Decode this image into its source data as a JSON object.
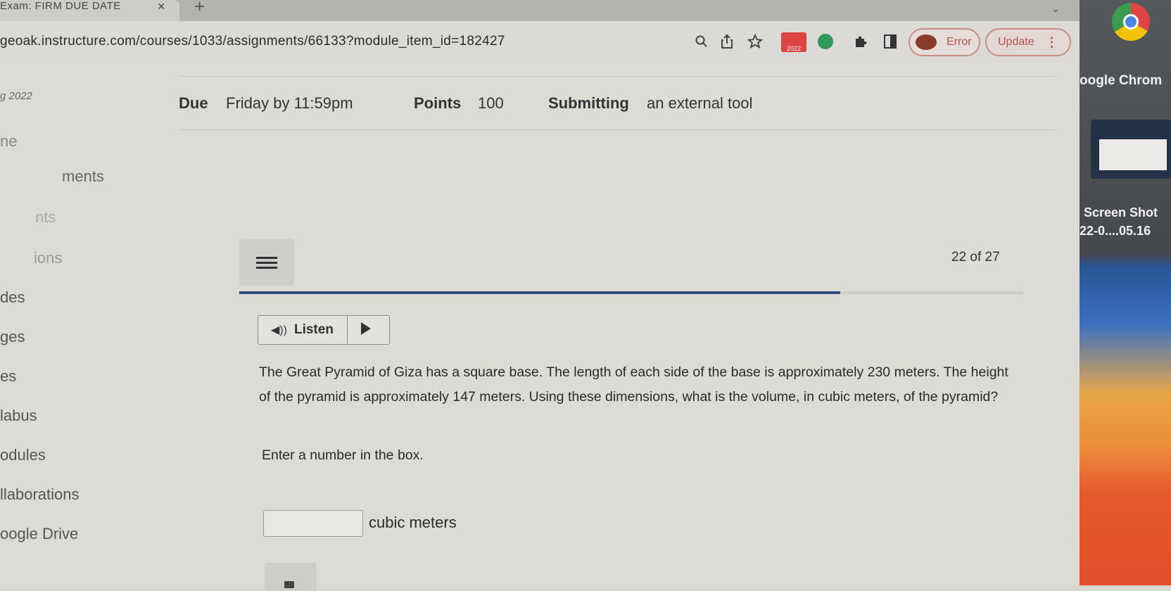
{
  "browser": {
    "tab_title": "Exam: FIRM DUE DATE",
    "tab_close": "×",
    "new_tab": "+",
    "tab_menu": "⌄",
    "url": "geoak.instructure.com/courses/1033/assignments/66133?module_item_id=182427",
    "gmail_badge": "2022",
    "error_label": "Error",
    "update_label": "Update",
    "update_more": "⋮",
    "icons": [
      "zoom-icon",
      "share-icon",
      "bookmark-star-icon",
      "gmail-icon",
      "grammarly-icon",
      "extensions-puzzle-icon",
      "sidebar-icon"
    ]
  },
  "desktop": {
    "chrome_label": "oogle Chrom",
    "screenshot_label_1": "Screen Shot",
    "screenshot_label_2": "22-0....05.16"
  },
  "sidebar": {
    "term": "g 2022",
    "items": [
      "ne",
      "ments",
      "nts",
      "ions",
      "des",
      "ges",
      "es",
      "labus",
      "odules",
      "llaborations",
      "oogle Drive"
    ]
  },
  "assignment": {
    "due_label": "Due",
    "due_value": "Friday by 11:59pm",
    "points_label": "Points",
    "points_value": "100",
    "submitting_label": "Submitting",
    "submitting_value": "an external tool"
  },
  "quiz": {
    "counter": "22 of 27",
    "progress_fraction": 0.767,
    "listen_label": "Listen",
    "question": "The Great Pyramid of Giza has a square base. The length of each side of the base is approximately 230 meters. The height of the pyramid is approximately 147 meters. Using these dimensions, what is the volume, in cubic meters, of the pyramid?",
    "instruction": "Enter a number in the box.",
    "answer_value": "",
    "unit": "cubic meters"
  },
  "colors": {
    "progress": "#2c4f7c",
    "error": "#b4534b"
  }
}
